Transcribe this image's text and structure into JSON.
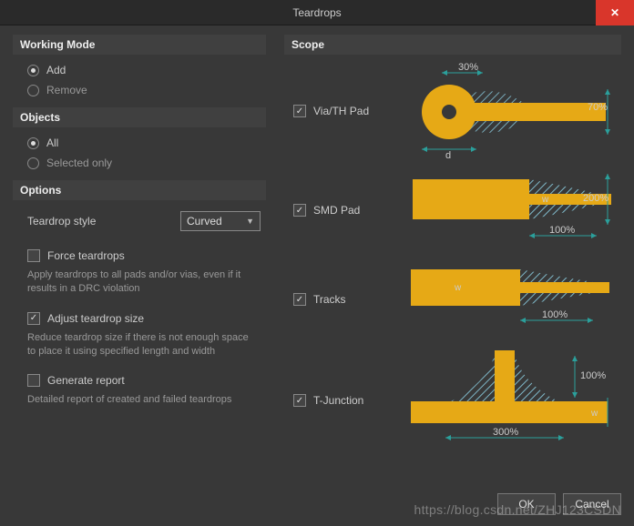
{
  "dialog": {
    "title": "Teardrops"
  },
  "working_mode": {
    "heading": "Working Mode",
    "add": "Add",
    "remove": "Remove"
  },
  "objects": {
    "heading": "Objects",
    "all": "All",
    "selected_only": "Selected only"
  },
  "options": {
    "heading": "Options",
    "teardrop_style_label": "Teardrop style",
    "teardrop_style_value": "Curved",
    "force": {
      "label": "Force teardrops",
      "desc": "Apply teardrops to all pads and/or vias, even if it results in a DRC violation"
    },
    "adjust": {
      "label": "Adjust teardrop size",
      "desc": "Reduce teardrop size if there is not enough space to place it using specified length and width"
    },
    "report": {
      "label": "Generate report",
      "desc": "Detailed report of created and failed teardrops"
    }
  },
  "scope": {
    "heading": "Scope",
    "via": {
      "label": "Via/TH Pad",
      "len_pct": "30%",
      "width_pct": "70%",
      "d_label": "d"
    },
    "smd": {
      "label": "SMD Pad",
      "len_pct": "100%",
      "width_pct": "200%",
      "w_label": "w"
    },
    "tracks": {
      "label": "Tracks",
      "len_pct": "100%",
      "w_label": "w"
    },
    "tjunction": {
      "label": "T-Junction",
      "len_pct": "300%",
      "width_pct": "100%",
      "w_label": "w"
    }
  },
  "buttons": {
    "ok": "OK",
    "cancel": "Cancel"
  },
  "watermark": "https://blog.csdn.net/ZHJ123CSDN"
}
